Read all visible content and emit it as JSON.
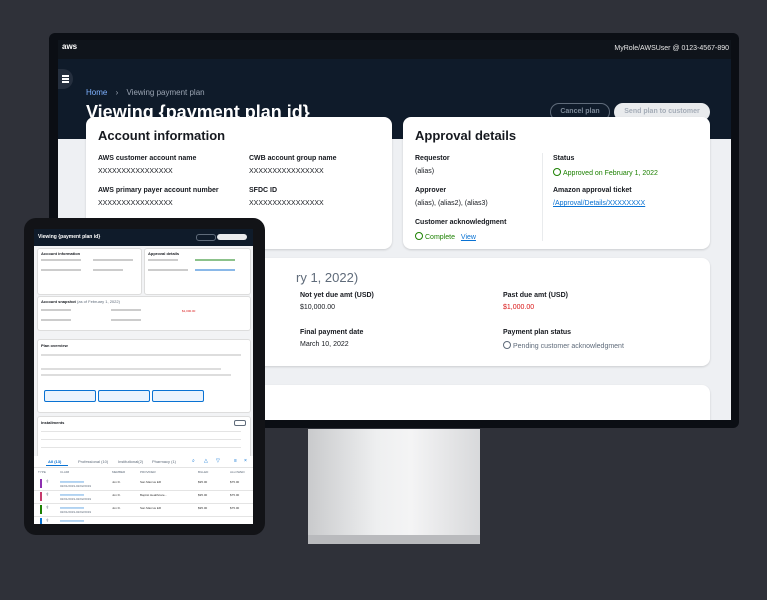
{
  "desktop": {
    "logo": "aws",
    "role": "MyRole/AWSUser @ 0123-4567-890",
    "breadcrumb": {
      "home": "Home",
      "current": "Viewing payment plan"
    },
    "title": "Viewing {payment plan id}",
    "buttons": {
      "cancel": "Cancel plan",
      "send": "Send plan to customer"
    },
    "account": {
      "title": "Account information",
      "customer_name_label": "AWS customer account name",
      "customer_name_value": "XXXXXXXXXXXXXXXX",
      "cwb_label": "CWB account group name",
      "cwb_value": "XXXXXXXXXXXXXXXX",
      "payer_label": "AWS primary payer account number",
      "payer_value": "XXXXXXXXXXXXXXXX",
      "sfdc_label": "SFDC ID",
      "sfdc_value": "XXXXXXXXXXXXXXXX"
    },
    "approval": {
      "title": "Approval details",
      "requestor_label": "Requestor",
      "requestor_value": "(alias)",
      "status_label": "Status",
      "status_value": "Approved on February 1, 2022",
      "approver_label": "Approver",
      "approver_value": "(alias), (alias2), (alias3)",
      "ticket_label": "Amazon approval ticket",
      "ticket_value": "/Approval/Details/XXXXXXXX",
      "ack_label": "Customer acknowledgment",
      "ack_value": "Complete",
      "ack_link": "View"
    },
    "snapshot": {
      "title_partial": "ry 1, 2022)",
      "not_yet_due_label": "Not yet due amt (USD)",
      "not_yet_due_value": "$10,000.00",
      "past_due_label": "Past due amt (USD)",
      "past_due_value": "$1,000.00",
      "final_date_label": "Final payment date",
      "final_date_value": "March 10, 2022",
      "plan_status_label": "Payment plan status",
      "plan_status_value": "Pending customer acknowledgment"
    }
  },
  "tablet": {
    "title": "Viewing {payment plan id}",
    "account_title": "Account information",
    "approval_title": "Approval details",
    "snapshot_title": "Account snapshot",
    "snapshot_suffix": "(as of February 1, 2022)",
    "past_due": "$1,000.00",
    "overview_title": "Plan overview",
    "installments_title": "Installments",
    "tabs": [
      "All (13)",
      "Professional (10)",
      "Institutional(2)",
      "Pharmacy (1)"
    ],
    "columns": [
      "TYPE",
      "CLAIM",
      "MEMBER",
      "PROVIDER",
      "BILLED",
      "ALLOWED"
    ],
    "rows": [
      {
        "claim": "XXXXXXXXXXXX",
        "date": "02/01/2019-02/02/2019",
        "member": "Jon D.",
        "provider": "San Marcus ER",
        "billed": "$95.00",
        "allowed": "$75.00",
        "color": "#8d2fb0"
      },
      {
        "claim": "XXXXXXXXXXXX",
        "date": "02/01/2019-02/02/2019",
        "member": "Jon D.",
        "provider": "Baptist Healthcare...",
        "billed": "$95.00",
        "allowed": "$75.00",
        "color": "#c63a6c"
      },
      {
        "claim": "XXXXXXXXXXXX",
        "date": "02/01/2019-02/02/2019",
        "member": "Jon D.",
        "provider": "San Marcus ER",
        "billed": "$95.00",
        "allowed": "$75.00",
        "color": "#1d8102"
      },
      {
        "claim": "XXXXXXXXXXXX",
        "date": "",
        "member": "",
        "provider": "",
        "billed": "",
        "allowed": "",
        "color": "#0972d3"
      }
    ]
  }
}
